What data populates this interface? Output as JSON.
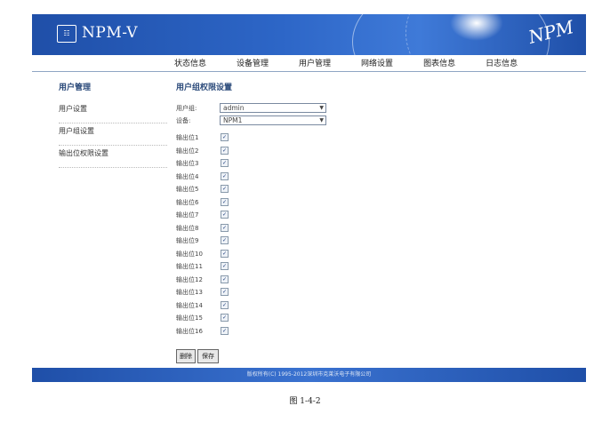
{
  "header": {
    "title": "NPM-V",
    "logo_text": "",
    "watermark": "NPM"
  },
  "nav": [
    "状态信息",
    "设备管理",
    "用户管理",
    "网络设置",
    "图表信息",
    "日志信息"
  ],
  "sidebar": {
    "title": "用户管理",
    "items": [
      "用户设置",
      "用户组设置",
      "输出位权限设置"
    ]
  },
  "main": {
    "title": "用户组权限设置",
    "group_label": "用户组:",
    "group_value": "admin",
    "device_label": "设备:",
    "device_value": "NPM1",
    "outputs": [
      "输出位1",
      "输出位2",
      "输出位3",
      "输出位4",
      "输出位5",
      "输出位6",
      "输出位7",
      "输出位8",
      "输出位9",
      "输出位10",
      "输出位11",
      "输出位12",
      "输出位13",
      "输出位14",
      "输出位15",
      "输出位16"
    ],
    "checked": "✓",
    "delete_label": "删除",
    "save_label": "保存"
  },
  "footer": {
    "copyright": "版权所有(C) 1995-2012深圳市克莱沃电子有限公司"
  },
  "caption": "图 1-4-2",
  "colors": {
    "banner": "#2d66c7",
    "footer": "#2a5fb8",
    "heading": "#2b4a7a"
  }
}
